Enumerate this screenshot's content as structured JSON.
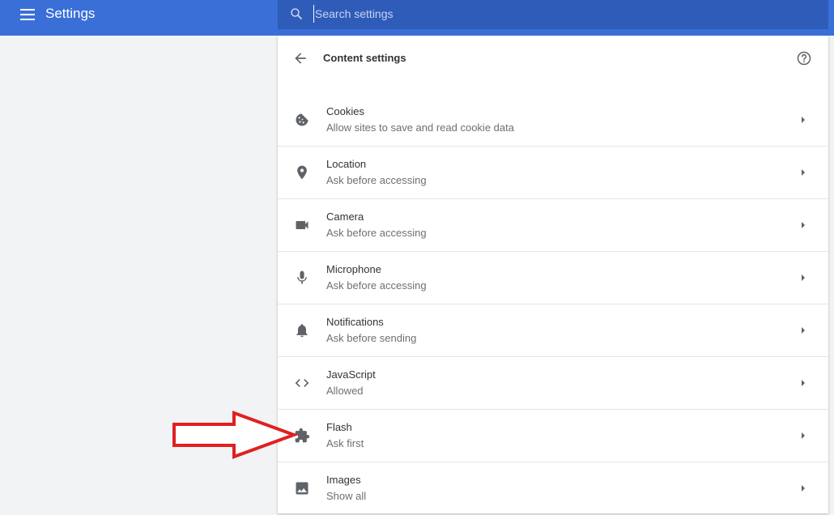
{
  "topbar": {
    "title": "Settings",
    "menu_icon": "hamburger-menu-icon",
    "bg_color": "#3a6fd8"
  },
  "search": {
    "placeholder": "Search settings",
    "value": "",
    "icon": "search-icon"
  },
  "content": {
    "title": "Content settings",
    "back_icon": "arrow-back-icon",
    "help_icon": "help-icon"
  },
  "items": [
    {
      "title": "Cookies",
      "subtitle": "Allow sites to save and read cookie data",
      "icon": "cookie-icon"
    },
    {
      "title": "Location",
      "subtitle": "Ask before accessing",
      "icon": "location-pin-icon"
    },
    {
      "title": "Camera",
      "subtitle": "Ask before accessing",
      "icon": "camera-icon"
    },
    {
      "title": "Microphone",
      "subtitle": "Ask before accessing",
      "icon": "microphone-icon"
    },
    {
      "title": "Notifications",
      "subtitle": "Ask before sending",
      "icon": "bell-icon"
    },
    {
      "title": "JavaScript",
      "subtitle": "Allowed",
      "icon": "code-icon"
    },
    {
      "title": "Flash",
      "subtitle": "Ask first",
      "icon": "puzzle-icon"
    },
    {
      "title": "Images",
      "subtitle": "Show all",
      "icon": "image-icon"
    }
  ],
  "annotation": {
    "arrow_color": "#e02020",
    "target": "Flash"
  }
}
